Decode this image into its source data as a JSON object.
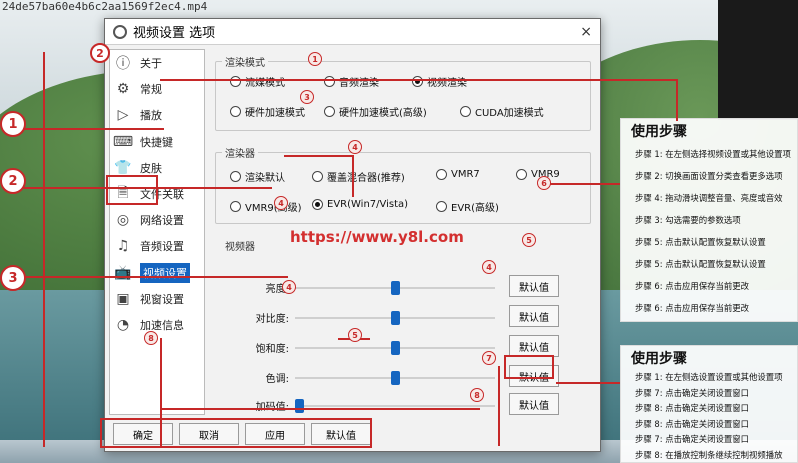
{
  "window_filename": "24de57ba60e4b6c2aa1569f2ec4.mp4",
  "dialog": {
    "title": "视频设置 选项",
    "close_icon": "×"
  },
  "sidebar": {
    "items": [
      {
        "label": "关于",
        "icon": "info-icon"
      },
      {
        "label": "常规",
        "icon": "gear-icon"
      },
      {
        "label": "播放",
        "icon": "play-icon"
      },
      {
        "label": "快捷键",
        "icon": "keyboard-icon"
      },
      {
        "label": "皮肤",
        "icon": "shirt-icon"
      },
      {
        "label": "文件关联",
        "icon": "file-icon"
      },
      {
        "label": "网络设置",
        "icon": "network-icon"
      },
      {
        "label": "音频设置",
        "icon": "music-icon"
      },
      {
        "label": "视频设置",
        "icon": "tv-icon"
      },
      {
        "label": "视窗设置",
        "icon": "window-icon"
      },
      {
        "label": "加速信息",
        "icon": "speedometer-icon"
      }
    ]
  },
  "render_mode": {
    "title": "渲染模式",
    "options": [
      {
        "label": "流媒模式",
        "checked": false
      },
      {
        "label": "音频渲染",
        "checked": false
      },
      {
        "label": "视频渲染",
        "checked": true
      },
      {
        "label": "硬件加速模式",
        "checked": false
      },
      {
        "label": "硬件加速模式(高级)",
        "checked": false
      },
      {
        "label": "CUDA加速模式",
        "checked": false
      }
    ]
  },
  "renderer": {
    "title": "渲染器",
    "options": [
      {
        "label": "渲染默认",
        "checked": false
      },
      {
        "label": "覆盖混合器(推荐)",
        "checked": false
      },
      {
        "label": "VMR7",
        "checked": false
      },
      {
        "label": "VMR9",
        "checked": false
      },
      {
        "label": "VMR9(高级)",
        "checked": false
      },
      {
        "label": "EVR(Win7/Vista)",
        "checked": true
      },
      {
        "label": "EVR(高级)",
        "checked": false
      }
    ]
  },
  "video": {
    "title": "视频器",
    "default_label": "默认值",
    "sliders": [
      {
        "label": "亮度:",
        "value": 0.5
      },
      {
        "label": "对比度:",
        "value": 0.5
      },
      {
        "label": "饱和度:",
        "value": 0.5
      },
      {
        "label": "色调:",
        "value": 0.5
      },
      {
        "label": "加码值:",
        "value": 0.0
      }
    ]
  },
  "footer": {
    "ok": "确定",
    "cancel": "取消",
    "apply": "应用",
    "default": "默认值"
  },
  "watermark": "https://www.y8l.com",
  "panel1": {
    "title": "使用步骤",
    "steps": [
      "步骤 1:  在左侧选择视频设置或其他设置项",
      "步骤 2:  切换画面设置分类查看更多选项",
      "步骤 4:  拖动滑块调整音量、亮度或音效",
      "步骤 3:  勾选需要的参数选项",
      "步骤 5:  点击默认配置恢复默认设置",
      "步骤 5:  点击默认配置恢复默认设置",
      "步骤 6:  点击应用保存当前更改",
      "步骤 6:  点击应用保存当前更改"
    ]
  },
  "panel2": {
    "title": "使用步骤",
    "steps": [
      "步骤 1:  在左侧选设置设置或其他设置项",
      "步骤 7:  点击确定关闭设置窗口",
      "步骤 8:  点击确定关闭设置窗口",
      "步骤 8:  点击确定关闭设置窗口",
      "步骤 7:  点击确定关闭设置窗口",
      "步骤 8:  在播放控制条继续控制视频播放"
    ]
  },
  "markers": [
    "1",
    "2",
    "3",
    "4",
    "5",
    "6",
    "7",
    "8"
  ],
  "colors": {
    "accent": "#1565c0",
    "annotation": "#c62828"
  }
}
